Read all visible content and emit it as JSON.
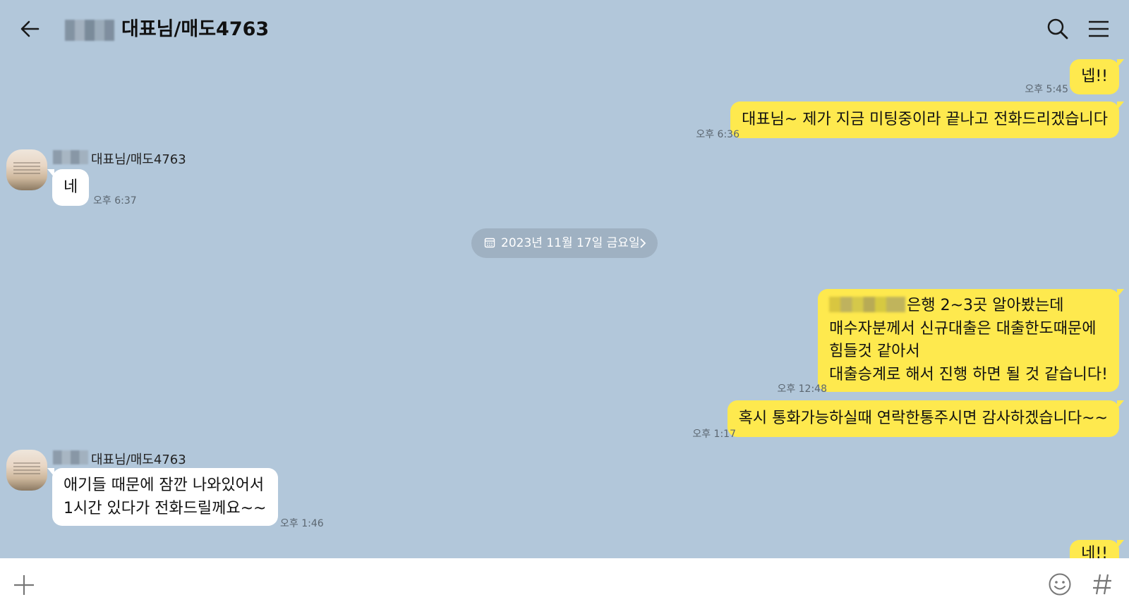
{
  "header": {
    "title": "대표님/매도4763",
    "icons": [
      "back-arrow-icon",
      "search-icon",
      "menu-icon"
    ]
  },
  "messages": {
    "m1": {
      "text": "넵!!",
      "time": "오후 5:45"
    },
    "m2": {
      "text": "대표님~ 제가 지금 미팅중이라 끝나고 전화드리겠습니다",
      "time": "오후 6:36"
    },
    "sender_name": "대표님/매도4763",
    "m3": {
      "text": "네",
      "time": "오후 6:37"
    },
    "date_divider": "2023년 11월 17일 금요일",
    "m4": {
      "line1": "은행 2~3곳 알아봤는데",
      "line2": "매수자분께서 신규대출은 대출한도때문에",
      "line3": "힘들것 같아서",
      "line4": "대출승계로 해서 진행 하면 될 것 같습니다!",
      "time": "오후 12:48"
    },
    "m5": {
      "text": "혹시 통화가능하실때 연락한통주시면 감사하겠습니다~~",
      "time": "오후 1:17"
    },
    "m6": {
      "line1": "애기들 때문에 잠깐 나와있어서",
      "line2": "1시간 있다가 전화드릴께요~~",
      "time": "오후 1:46"
    },
    "m7": {
      "text": "네!!"
    }
  },
  "input": {
    "icons": [
      "plus-icon",
      "emoji-icon",
      "hashtag-icon"
    ]
  },
  "colors": {
    "background": "#b2c7da",
    "my_bubble": "#fee94e",
    "their_bubble": "#ffffff",
    "date_pill": "#9fb1c2"
  }
}
